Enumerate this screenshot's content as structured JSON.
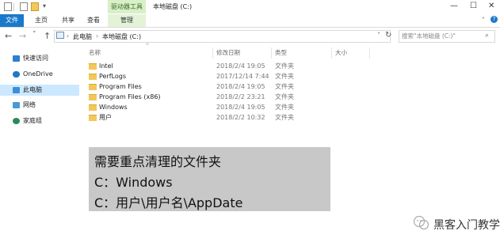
{
  "titlebar": {
    "drive_tools": "驱动器工具",
    "window_title": "本地磁盘 (C:)",
    "minimize": "—",
    "maximize": "☐",
    "close": "✕"
  },
  "ribbon": {
    "file": "文件",
    "tabs": [
      "主页",
      "共享",
      "查看"
    ],
    "manage": "管理"
  },
  "address": {
    "back": "←",
    "forward": "→",
    "recent": "˅",
    "up": "↑",
    "crumbs": [
      "此电脑",
      "本地磁盘 (C:)"
    ],
    "search_placeholder": "搜索\"本地磁盘 (C:)\""
  },
  "nav": {
    "items": [
      {
        "label": "快速访问",
        "icon": "star-icon",
        "color": "#2b7fd4"
      },
      {
        "label": "OneDrive",
        "icon": "cloud-icon",
        "color": "#1f78c8"
      },
      {
        "label": "此电脑",
        "icon": "computer-icon",
        "color": "#3b8fd8"
      },
      {
        "label": "网络",
        "icon": "network-icon",
        "color": "#4a9ad8"
      },
      {
        "label": "家庭组",
        "icon": "homegroup-icon",
        "color": "#2a8a5a"
      }
    ]
  },
  "columns": {
    "name": "名称",
    "date": "修改日期",
    "type": "类型",
    "size": "大小"
  },
  "files": [
    {
      "name": "Intel",
      "date": "2018/2/4 19:05",
      "type": "文件夹"
    },
    {
      "name": "PerfLogs",
      "date": "2017/12/14 7:44",
      "type": "文件夹"
    },
    {
      "name": "Program Files",
      "date": "2018/2/4 19:05",
      "type": "文件夹"
    },
    {
      "name": "Program Files (x86)",
      "date": "2018/2/2 23:21",
      "type": "文件夹"
    },
    {
      "name": "Windows",
      "date": "2018/2/4 19:05",
      "type": "文件夹"
    },
    {
      "name": "用户",
      "date": "2018/2/2 10:32",
      "type": "文件夹"
    }
  ],
  "overlay": {
    "line1": "需要重点清理的文件夹",
    "line2": "C：Windows",
    "line3": "C：用户\\用户名\\AppDate"
  },
  "watermark": "黑客入门教学"
}
